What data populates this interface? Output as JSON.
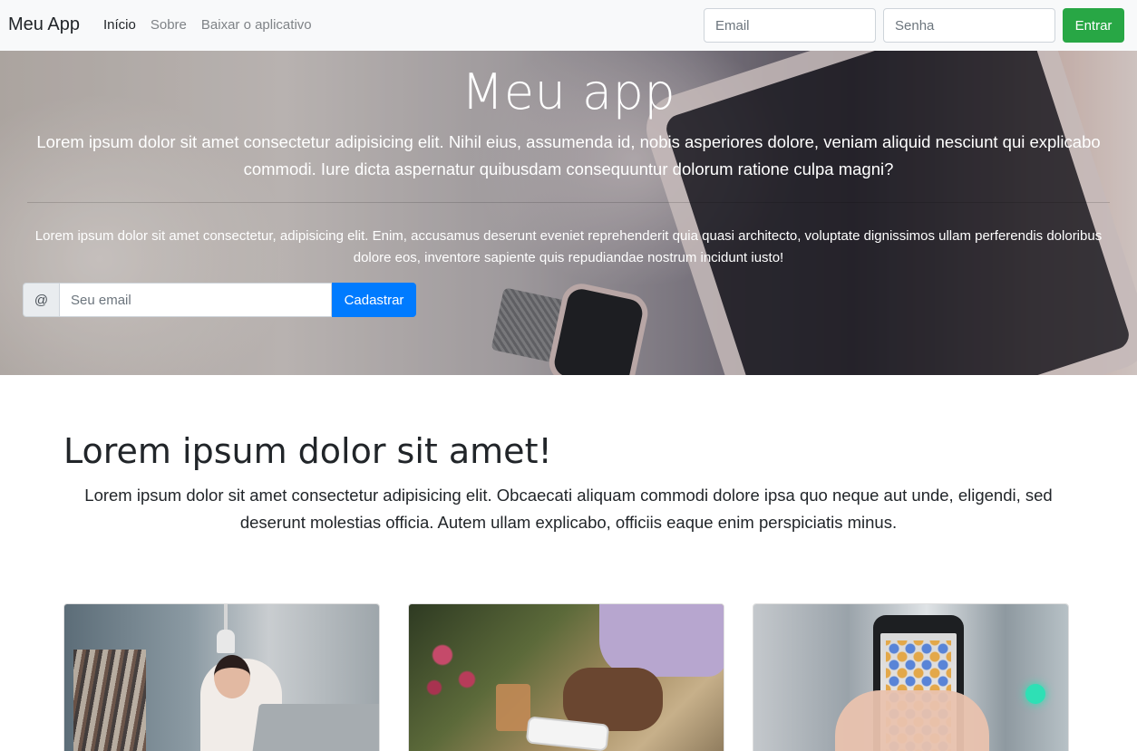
{
  "navbar": {
    "brand": "Meu App",
    "links": [
      "Início",
      "Sobre",
      "Baixar o aplicativo"
    ],
    "email_placeholder": "Email",
    "senha_placeholder": "Senha",
    "entrar_label": "Entrar"
  },
  "hero": {
    "title": "Meu app",
    "lead": "Lorem ipsum dolor sit amet consectetur adipisicing elit. Nihil eius, assumenda id, nobis asperiores dolore, veniam aliquid nesciunt qui explicabo commodi. Iure dicta aspernatur quibusdam consequuntur dolorum ratione culpa magni?",
    "text": "Lorem ipsum dolor sit amet consectetur, adipisicing elit. Enim, accusamus deserunt eveniet reprehenderit quia quasi architecto, voluptate dignissimos ullam perferendis doloribus dolore eos, inventore sapiente quis repudiandae nostrum incidunt iusto!",
    "signup": {
      "prepend": "@",
      "placeholder": "Seu email",
      "button_label": "Cadastrar"
    }
  },
  "section": {
    "title": "Lorem ipsum dolor sit amet!",
    "lead": "Lorem ipsum dolor sit amet consectetur adipisicing elit. Obcaecati aliquam commodi dolore ipsa quo neque aut unde, eligendi, sed deserunt molestias officia. Autem ullam explicabo, officiis eaque enim perspiciatis minus."
  },
  "colors": {
    "navbar_bg": "#f8f9fa",
    "entrar_button": "#28a745",
    "cadastrar_button": "#007bff"
  }
}
